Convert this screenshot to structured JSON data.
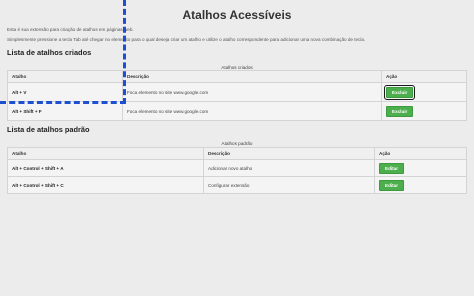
{
  "page": {
    "title": "Atalhos Acessíveis",
    "intro_line1": "Esta é sua extensão para criação de atalhos em páginas web.",
    "intro_line2": "Simplesmente pressione a tecla Tab até chegar no elemento para o qual deseja criar um atalho e utilize o atalho correspondente para adicionar uma nova combinação de tecla."
  },
  "created": {
    "section_title": "Lista de atalhos criados",
    "caption": "Atalhos criados",
    "headers": [
      "Atalho",
      "Descrição",
      "Ação"
    ],
    "rows": [
      {
        "shortcut": "Alt + V",
        "description": "Foca elemento no site www.google.com",
        "action": "Excluir"
      },
      {
        "shortcut": "Alt + Shift + F",
        "description": "Foca elemento no site www.google.com",
        "action": "Excluir"
      }
    ]
  },
  "defaults": {
    "section_title": "Lista de atalhos padrão",
    "caption": "Atalhos padrão",
    "headers": [
      "Atalho",
      "Descrição",
      "Ação"
    ],
    "rows": [
      {
        "shortcut": "Alt + Control + Shift + A",
        "description": "Adicionar novo atalho",
        "action": "Editar"
      },
      {
        "shortcut": "Alt + Control + Shift + C",
        "description": "Configurar extensão",
        "action": "Editar"
      }
    ]
  },
  "colors": {
    "button_green": "#4cae4c",
    "focus_outline": "#1f4fd1",
    "page_background": "#ececec"
  }
}
